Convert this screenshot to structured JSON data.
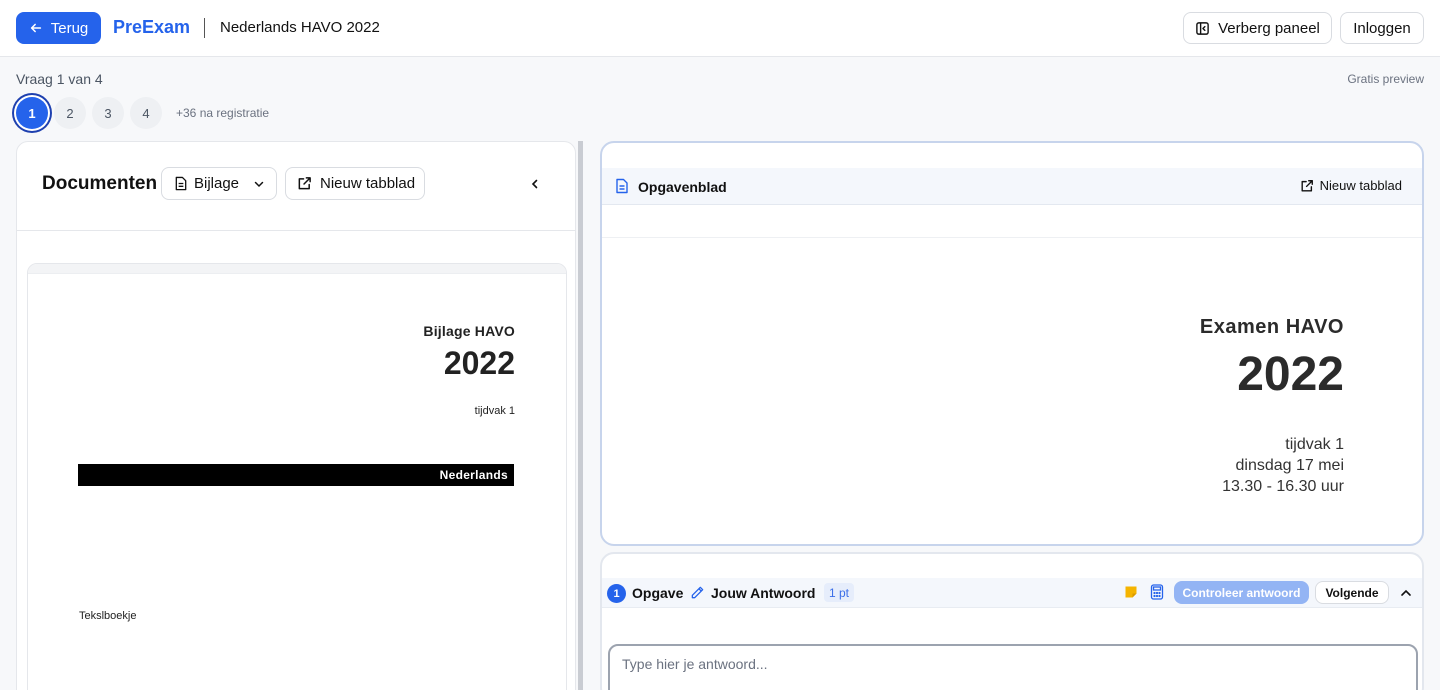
{
  "header": {
    "back_label": "Terug",
    "brand": "PreExam",
    "exam_title": "Nederlands HAVO 2022",
    "panel_toggle_label": "Verberg paneel",
    "login_label": "Inloggen"
  },
  "question_nav": {
    "label": "Vraag 1 van 4",
    "preview_label": "Gratis preview",
    "questions": [
      "1",
      "2",
      "3",
      "4"
    ],
    "active_index": 0,
    "more_label": "+36 na registratie"
  },
  "documents": {
    "title": "Documenten",
    "selected_doc": "Bijlage",
    "new_tab_label": "Nieuw tabblad",
    "page": {
      "heading": "Bijlage HAVO",
      "year": "2022",
      "tijdvak": "tijdvak 1",
      "subject": "Nederlands",
      "footer": "Tekslboekje"
    }
  },
  "opgavenblad": {
    "title": "Opgavenblad",
    "new_tab_label": "Nieuw tabblad",
    "page": {
      "heading": "Examen HAVO",
      "year": "2022",
      "line1": "tijdvak 1",
      "line2": "dinsdag 17 mei",
      "line3": "13.30 - 16.30 uur"
    }
  },
  "answer_panel": {
    "number": "1",
    "opgave_label": "Opgave",
    "answer_label": "Jouw Antwoord",
    "points": "1 pt",
    "check_label": "Controleer antwoord",
    "next_label": "Volgende",
    "input_placeholder": "Type hier je antwoord...",
    "input_value": ""
  },
  "colors": {
    "accent": "#2563eb",
    "check_button": "#93b4f4",
    "note_icon": "#f5b400"
  }
}
